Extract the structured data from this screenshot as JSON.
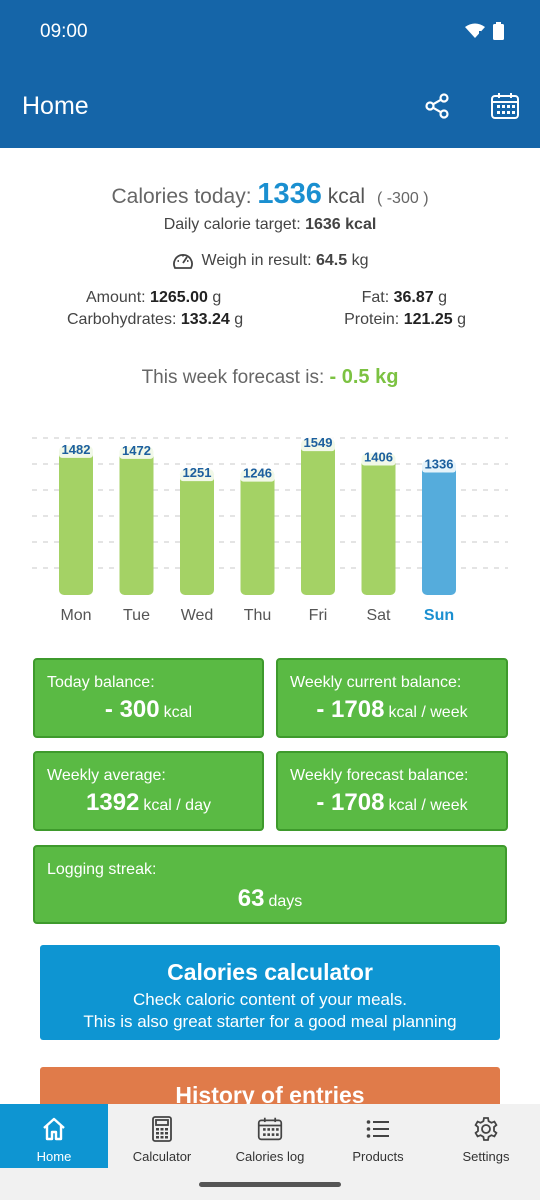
{
  "status_bar": {
    "time": "09:00"
  },
  "app_bar": {
    "title": "Home",
    "actions": [
      "share-icon",
      "calendar-icon"
    ]
  },
  "summary": {
    "calories_prefix": "Calories today:",
    "calories_value": "1336",
    "calories_unit": "kcal",
    "calories_delta": "( -300 )",
    "daily_target_label": "Daily calorie target:",
    "daily_target_value": "1636 kcal",
    "weigh_label": "Weigh in result:",
    "weigh_value": "64.5",
    "weigh_unit": "kg",
    "amount_label": "Amount:",
    "amount_value": "1265.00",
    "amount_unit": "g",
    "carbs_label": "Carbohydrates:",
    "carbs_value": "133.24",
    "carbs_unit": "g",
    "fat_label": "Fat:",
    "fat_value": "36.87",
    "fat_unit": "g",
    "protein_label": "Protein:",
    "protein_value": "121.25",
    "protein_unit": "g",
    "forecast_label": "This week forecast is:",
    "forecast_value": "- 0.5 kg"
  },
  "chart_data": {
    "type": "bar",
    "categories": [
      "Mon",
      "Tue",
      "Wed",
      "Thu",
      "Fri",
      "Sat",
      "Sun"
    ],
    "values": [
      1482,
      1472,
      1251,
      1246,
      1549,
      1406,
      1336
    ],
    "highlight_category": "Sun",
    "bar_color": "#a4d265",
    "highlight_color": "#55acdc",
    "label_color": "#1c5f9e",
    "ylim": [
      0,
      1560
    ],
    "grid": true
  },
  "cards": {
    "today_balance": {
      "label": "Today balance:",
      "value": "- 300",
      "unit": "kcal"
    },
    "weekly_current": {
      "label": "Weekly current balance:",
      "value": "- 1708",
      "unit": "kcal / week"
    },
    "weekly_average": {
      "label": "Weekly average:",
      "value": "1392",
      "unit": "kcal / day"
    },
    "weekly_forecast": {
      "label": "Weekly forecast balance:",
      "value": "- 1708",
      "unit": "kcal / week"
    },
    "logging_streak": {
      "label": "Logging streak:",
      "value": "63",
      "unit": "days"
    }
  },
  "calculator_button": {
    "title": "Calories calculator",
    "line1": "Check caloric content of your meals.",
    "line2": "This is also great starter for a good meal planning"
  },
  "history_button": {
    "title": "History of entries"
  },
  "nav": [
    {
      "label": "Home",
      "icon": "home-icon",
      "active": true
    },
    {
      "label": "Calculator",
      "icon": "calculator-icon",
      "active": false
    },
    {
      "label": "Calories log",
      "icon": "calendar-icon",
      "active": false
    },
    {
      "label": "Products",
      "icon": "list-icon",
      "active": false
    },
    {
      "label": "Settings",
      "icon": "gear-icon",
      "active": false
    }
  ],
  "colors": {
    "primary": "#1565a8",
    "accent_blue": "#0e95d2",
    "card_green": "#5aba44",
    "forecast_green": "#7cc242",
    "history_orange": "#e07b4a"
  }
}
